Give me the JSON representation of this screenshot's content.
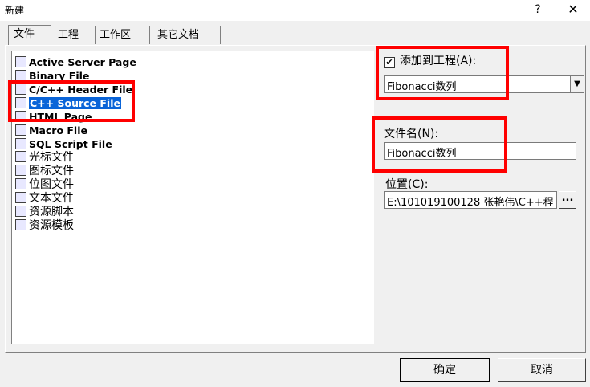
{
  "window": {
    "title": "新建",
    "help": "?",
    "close": "✕"
  },
  "tabs": [
    {
      "label": "文件"
    },
    {
      "label": "工程"
    },
    {
      "label": "工作区"
    },
    {
      "label": "其它文档"
    }
  ],
  "file_types": [
    {
      "label": "Active Server Page",
      "icon": "asp-file-icon"
    },
    {
      "label": "Binary File",
      "icon": "binary-file-icon"
    },
    {
      "label": "C/C++ Header File",
      "icon": "header-file-icon"
    },
    {
      "label": "C++ Source File",
      "icon": "cpp-source-icon",
      "selected": true
    },
    {
      "label": "HTML Page",
      "icon": "html-page-icon"
    },
    {
      "label": "Macro File",
      "icon": "macro-file-icon"
    },
    {
      "label": "SQL Script File",
      "icon": "sql-script-icon"
    },
    {
      "label": "光标文件",
      "icon": "cursor-file-icon"
    },
    {
      "label": "图标文件",
      "icon": "icon-file-icon"
    },
    {
      "label": "位图文件",
      "icon": "bitmap-file-icon"
    },
    {
      "label": "文本文件",
      "icon": "text-file-icon"
    },
    {
      "label": "资源脚本",
      "icon": "resource-script-icon"
    },
    {
      "label": "资源模板",
      "icon": "resource-template-icon"
    }
  ],
  "add_to_project": {
    "label": "添加到工程(A):",
    "checked": true,
    "mark": "✔"
  },
  "project_combo": {
    "value": "Fibonacci数列",
    "arrow": "▼"
  },
  "file_name": {
    "label": "文件名(N):",
    "value": "Fibonacci数列"
  },
  "location": {
    "label": "位置(C):",
    "value": "E:\\101019100128 张艳伟\\C++程",
    "browse": "..."
  },
  "buttons": {
    "ok": "确定",
    "cancel": "取消"
  },
  "colors": {
    "highlight_box": "#ff0000",
    "selection": "#0a64d8"
  }
}
